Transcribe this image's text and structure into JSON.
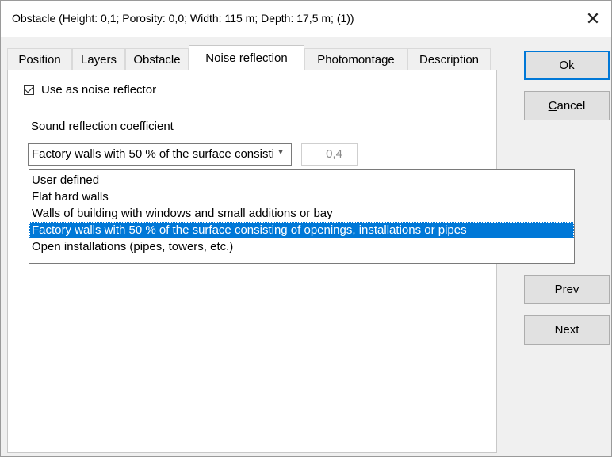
{
  "window": {
    "title": "Obstacle   (Height: 0,1; Porosity: 0,0; Width: 115 m; Depth: 17,5 m; (1))",
    "close_glyph": "✕"
  },
  "tabs": [
    {
      "label": "Position",
      "active": false
    },
    {
      "label": "Layers",
      "active": false
    },
    {
      "label": "Obstacle",
      "active": false
    },
    {
      "label": "Noise reflection",
      "active": true
    },
    {
      "label": "Photomontage",
      "active": false
    },
    {
      "label": "Description",
      "active": false
    }
  ],
  "noise_reflection": {
    "use_as_reflector_label": "Use as noise reflector",
    "use_as_reflector_checked": true,
    "coefficient_label": "Sound reflection coefficient",
    "combo_value": "Factory walls with 50 % of the surface consisting of openings, installations or pipes",
    "coefficient_value": "0,4",
    "options": [
      "User defined",
      "Flat hard walls",
      "Walls of building with windows and small additions or bay",
      "Factory walls with 50 % of the surface consisting of openings, installations or pipes",
      "Open installations (pipes, towers, etc.)"
    ],
    "selected_index": 3
  },
  "buttons": {
    "ok_rest": "k",
    "ok_mnemonic": "O",
    "cancel_rest": "ancel",
    "cancel_mnemonic": "C",
    "prev": "Prev",
    "next": "Next"
  },
  "colors": {
    "selection": "#0078d7",
    "dialog_bg": "#f0f0f0"
  }
}
